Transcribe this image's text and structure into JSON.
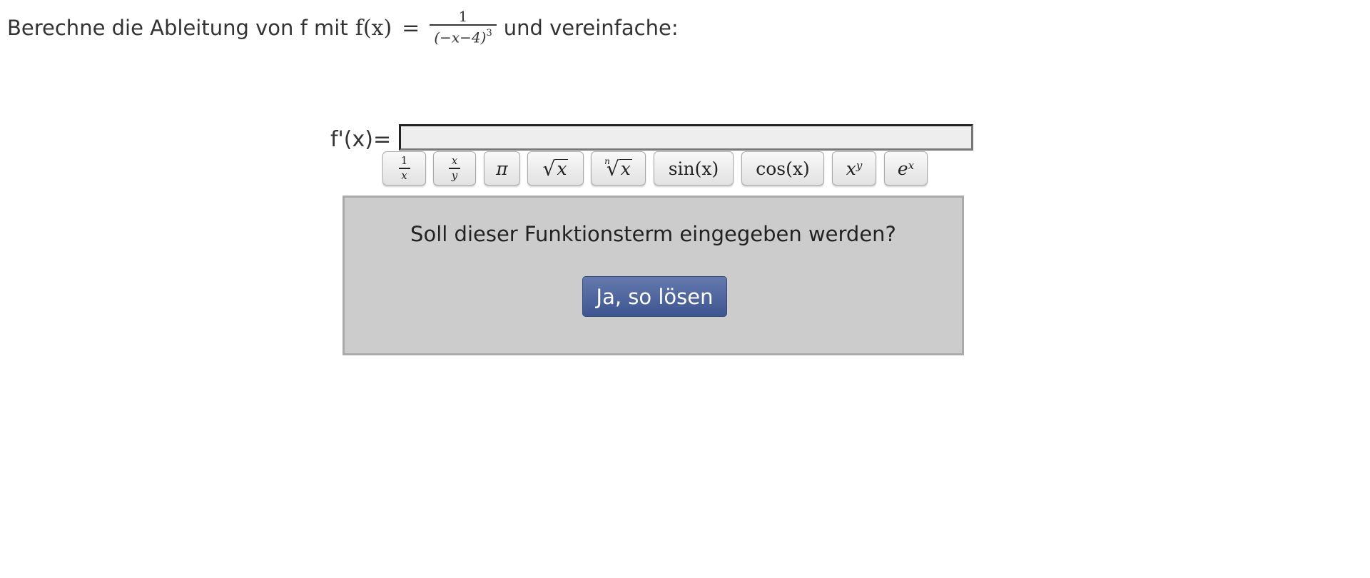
{
  "task": {
    "prefix": "Berechne die Ableitung von f mit",
    "function_name": "f(x)",
    "equals": "=",
    "numerator": "1",
    "denominator": "(−x−4)",
    "exponent": "3",
    "suffix": "und vereinfache:"
  },
  "answer": {
    "label": "f'(x)=",
    "value": "",
    "placeholder": ""
  },
  "keyboard": {
    "keys": [
      {
        "name": "reciprocal",
        "top": "1",
        "bottom": "x"
      },
      {
        "name": "fraction",
        "top": "x",
        "bottom": "y"
      },
      {
        "name": "pi",
        "label": "π"
      },
      {
        "name": "sqrt",
        "radicand": "x"
      },
      {
        "name": "nth-root",
        "index": "n",
        "radicand": "x"
      },
      {
        "name": "sin",
        "label": "sin(x)"
      },
      {
        "name": "cos",
        "label": "cos(x)"
      },
      {
        "name": "power",
        "base": "x",
        "exponent": "y"
      },
      {
        "name": "exp",
        "base": "e",
        "exponent": "x"
      }
    ]
  },
  "confirm": {
    "question": "Soll dieser Funktionsterm eingegeben werden?",
    "button_label": "Ja, so lösen",
    "background_color": "#cccccc",
    "button_color": "#4b629c"
  }
}
